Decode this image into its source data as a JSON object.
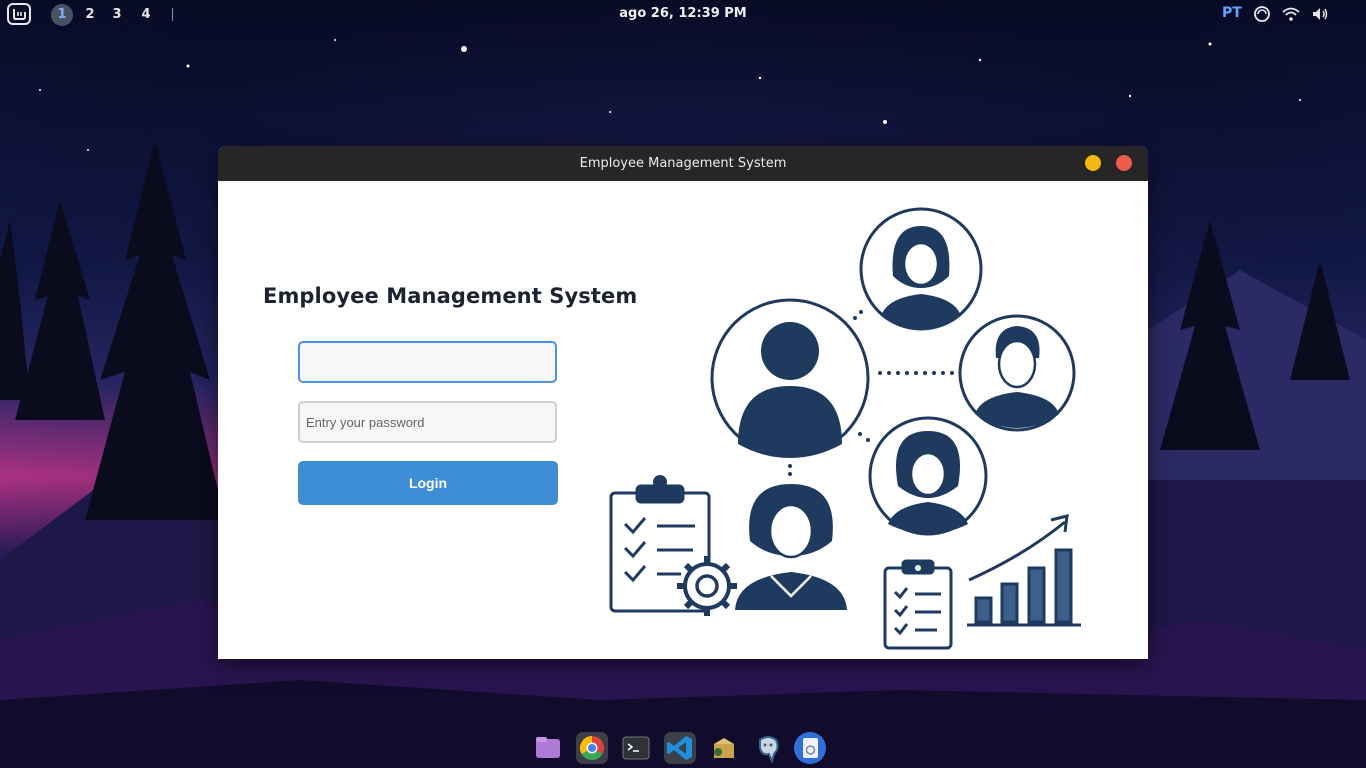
{
  "topbar": {
    "workspaces": [
      "1",
      "2",
      "3",
      "4"
    ],
    "active_workspace": "1",
    "clock": "ago 26,  12:39 PM",
    "keyboard_layout": "PT"
  },
  "window": {
    "title": "Employee Management System"
  },
  "login": {
    "heading": "Employee Management System",
    "username_value": "",
    "password_placeholder": "Entry your password",
    "login_label": "Login"
  },
  "dock": {
    "items": [
      "files-icon",
      "chrome-icon",
      "terminal-icon",
      "vscode-icon",
      "db-tool-icon",
      "postgresql-icon",
      "app-icon"
    ]
  },
  "colors": {
    "accent": "#3d8ed6",
    "illustration": "#1e3a5f",
    "titlebar": "#262626"
  }
}
